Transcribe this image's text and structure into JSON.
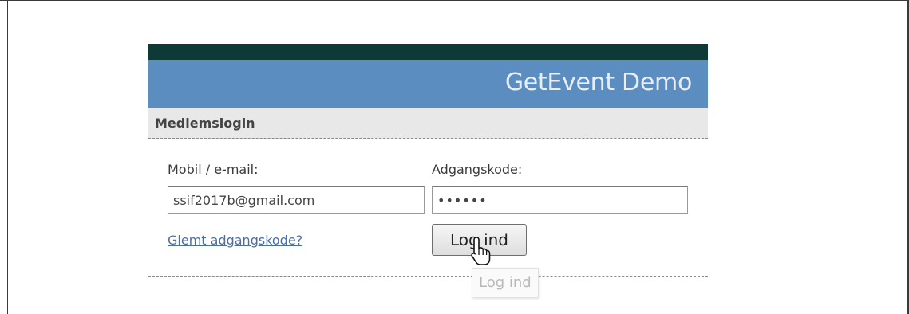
{
  "header": {
    "title": "GetEvent Demo"
  },
  "section": {
    "title": "Medlemslogin"
  },
  "login_form": {
    "username_label": "Mobil / e-mail:",
    "username_value": "ssif2017b@gmail.com",
    "password_label": "Adgangskode:",
    "password_value": "••••••",
    "forgot_link": "Glemt adgangskode?",
    "submit_label": "Log ind"
  },
  "tooltip": {
    "text": "Log ind"
  },
  "colors": {
    "top_bar": "#0d3a37",
    "banner": "#5b8dc0",
    "section_bar": "#e8e8e8",
    "link": "#4a6fa8"
  }
}
